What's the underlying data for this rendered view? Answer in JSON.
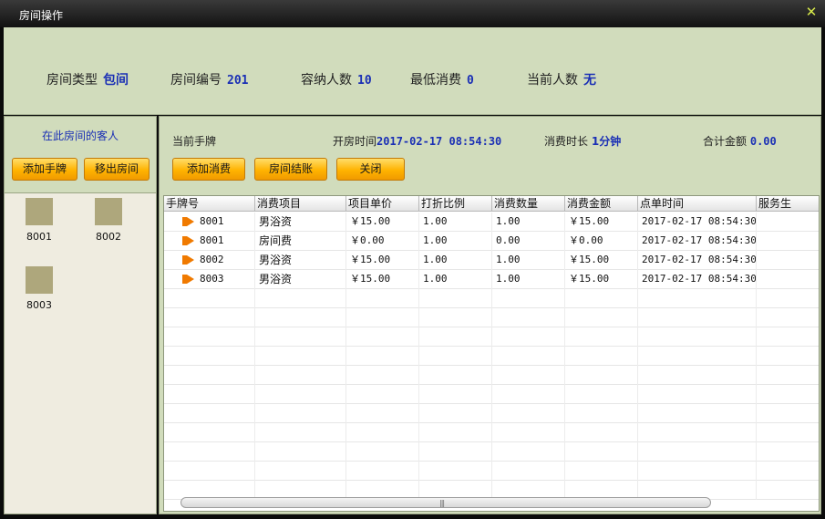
{
  "window": {
    "title": "房间操作"
  },
  "room_info": {
    "type_label": "房间类型",
    "type_value": "包间",
    "number_label": "房间编号",
    "number_value": "201",
    "capacity_label": "容纳人数",
    "capacity_value": "10",
    "min_spend_label": "最低消费",
    "min_spend_value": "0",
    "current_label": "当前人数",
    "current_value": "无"
  },
  "guests_panel": {
    "title": "在此房间的客人",
    "add_button": "添加手牌",
    "remove_button": "移出房间",
    "guests": [
      "8001",
      "8002",
      "8003"
    ]
  },
  "consumption": {
    "current_card_label": "当前手牌",
    "open_time_label": "开房时间",
    "open_time_value": "2017-02-17 08:54:30",
    "duration_label": "消费时长",
    "duration_value": "1分钟",
    "total_label": "合计金额",
    "total_value": "0.00",
    "buttons": {
      "add": "添加消费",
      "checkout": "房间结账",
      "close": "关闭"
    }
  },
  "table": {
    "columns": [
      "手牌号",
      "消费项目",
      "项目单价",
      "打折比例",
      "消费数量",
      "消费金额",
      "点单时间",
      "服务生"
    ],
    "rows": [
      [
        "8001",
        "男浴资",
        "￥15.00",
        "1.00",
        "1.00",
        "￥15.00",
        "2017-02-17 08:54:30",
        ""
      ],
      [
        "8001",
        "房间费",
        "￥0.00",
        "1.00",
        "0.00",
        "￥0.00",
        "2017-02-17 08:54:30",
        ""
      ],
      [
        "8002",
        "男浴资",
        "￥15.00",
        "1.00",
        "1.00",
        "￥15.00",
        "2017-02-17 08:54:30",
        ""
      ],
      [
        "8003",
        "男浴资",
        "￥15.00",
        "1.00",
        "1.00",
        "￥15.00",
        "2017-02-17 08:54:30",
        ""
      ]
    ]
  },
  "icons": {
    "close": "close-icon",
    "row_marker": "arrow-right-icon"
  },
  "colors": {
    "accent_value": "#1a2fb5",
    "panel_bg": "#d1dcbc",
    "button_orange": "#ffb300"
  }
}
